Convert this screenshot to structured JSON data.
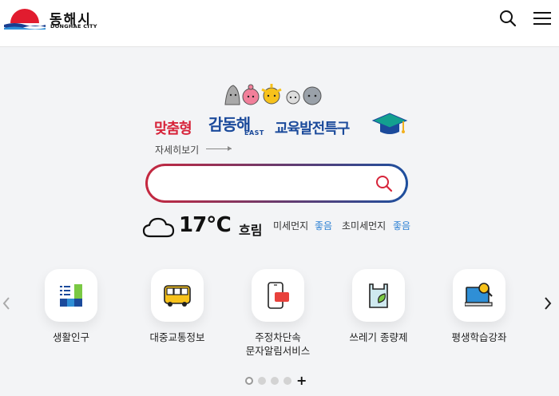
{
  "header": {
    "logo_ko": "동해시",
    "logo_en": "DONGHAE CITY"
  },
  "hero": {
    "banner_part1": "맞춤형",
    "banner_part2": "감동해",
    "banner_part2_sub": "EAST",
    "banner_part3": "교육발전특구",
    "more_link": "자세히보기"
  },
  "search": {
    "placeholder": "",
    "value": ""
  },
  "weather": {
    "temperature": "17℃",
    "condition": "흐림",
    "fine_dust_label": "미세먼지",
    "fine_dust_value": "좋음",
    "ultra_fine_dust_label": "초미세먼지",
    "ultra_fine_dust_value": "좋음"
  },
  "quick_menu": [
    {
      "label": "생활인구",
      "icon": "bar-chart-icon"
    },
    {
      "label": "대중교통정보",
      "icon": "bus-icon"
    },
    {
      "label": "주정차단속\n문자알림서비스",
      "icon": "phone-message-icon"
    },
    {
      "label": "쓰레기 종량제",
      "icon": "trash-bag-icon"
    },
    {
      "label": "평생학습강좌",
      "icon": "monitor-search-icon"
    }
  ],
  "pagination": {
    "total_dots": 4,
    "active_index": 0
  },
  "colors": {
    "brand_red": "#d7243a",
    "brand_blue": "#1b4a9b",
    "dust_good": "#2b7fd3"
  }
}
